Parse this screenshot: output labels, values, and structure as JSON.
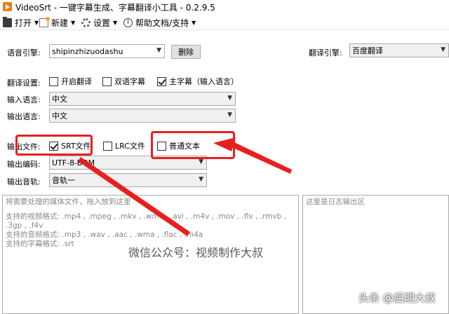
{
  "window": {
    "title": "VideoSrt - 一键字幕生成、字幕翻译小工具 - 0.2.9.5"
  },
  "menu": {
    "open": "打开",
    "new": "新建",
    "settings": "设置",
    "help": "帮助文档/支持"
  },
  "voice_engine": {
    "label": "语音引擎:",
    "value": "shipinzhizuodashu",
    "delete_label": "删除"
  },
  "translate_engine": {
    "label": "翻译引擎:",
    "value": "百度翻译"
  },
  "translate_settings": {
    "label": "翻译设置:",
    "enable_translate": "开启翻译",
    "bilingual": "双语字幕",
    "main_subtitle": "主字幕（输入语言）"
  },
  "input_language": {
    "label": "输入语言:",
    "value": "中文"
  },
  "output_language": {
    "label": "输出语言:",
    "value": "中文"
  },
  "output_file": {
    "label": "输出文件:",
    "srt": "SRT文件",
    "lrc": "LRC文件",
    "plain": "普通文本"
  },
  "output_encoding": {
    "label": "输出编码:",
    "value": "UTF-8-BOM"
  },
  "output_track": {
    "label": "输出音轨:",
    "value": "音轨一"
  },
  "media_panel": {
    "hint": "将需要处理的媒体文件，拖入放到这里",
    "video_formats": "支持的视频格式: .mp4 , .mpeg , .mkv , .wmv , .avi , .m4v , .mov , .flv , .rmvb , .3gp , .f4v",
    "audio_formats": "支持的音频格式: .mp3 , .wav , .aac , .wma , .flac , .m4a",
    "subtitle_formats": "支持的字幕格式: .srt"
  },
  "log_panel": {
    "placeholder": "这里是日志输出区"
  },
  "watermark": {
    "center": "微信公众号：视频制作大叔",
    "corner": "头条 @后期大叔"
  },
  "colors": {
    "highlight": "#e8201d"
  }
}
